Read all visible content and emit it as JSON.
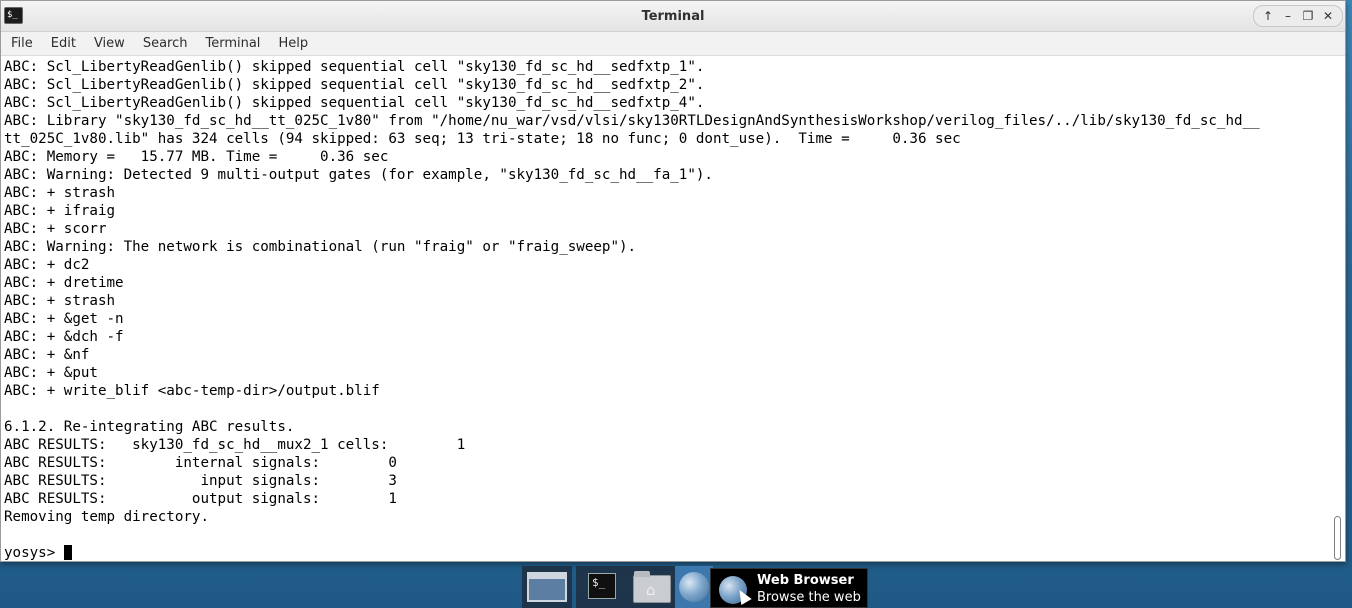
{
  "window": {
    "title": "Terminal",
    "app_icon_glyph": "$_"
  },
  "wm_buttons": {
    "up": "↑",
    "minimize": "–",
    "maximize": "❐",
    "close": "✕"
  },
  "menu": [
    "File",
    "Edit",
    "View",
    "Search",
    "Terminal",
    "Help"
  ],
  "terminal": {
    "lines": [
      "ABC: Scl_LibertyReadGenlib() skipped sequential cell \"sky130_fd_sc_hd__sedfxtp_1\".",
      "ABC: Scl_LibertyReadGenlib() skipped sequential cell \"sky130_fd_sc_hd__sedfxtp_2\".",
      "ABC: Scl_LibertyReadGenlib() skipped sequential cell \"sky130_fd_sc_hd__sedfxtp_4\".",
      "ABC: Library \"sky130_fd_sc_hd__tt_025C_1v80\" from \"/home/nu_war/vsd/vlsi/sky130RTLDesignAndSynthesisWorkshop/verilog_files/../lib/sky130_fd_sc_hd__",
      "tt_025C_1v80.lib\" has 324 cells (94 skipped: 63 seq; 13 tri-state; 18 no func; 0 dont_use).  Time =     0.36 sec",
      "ABC: Memory =   15.77 MB. Time =     0.36 sec",
      "ABC: Warning: Detected 9 multi-output gates (for example, \"sky130_fd_sc_hd__fa_1\").",
      "ABC: + strash",
      "ABC: + ifraig",
      "ABC: + scorr",
      "ABC: Warning: The network is combinational (run \"fraig\" or \"fraig_sweep\").",
      "ABC: + dc2",
      "ABC: + dretime",
      "ABC: + strash",
      "ABC: + &get -n",
      "ABC: + &dch -f",
      "ABC: + &nf",
      "ABC: + &put",
      "ABC: + write_blif <abc-temp-dir>/output.blif",
      "",
      "6.1.2. Re-integrating ABC results.",
      "ABC RESULTS:   sky130_fd_sc_hd__mux2_1 cells:        1",
      "ABC RESULTS:        internal signals:        0",
      "ABC RESULTS:           input signals:        3",
      "ABC RESULTS:          output signals:        1",
      "Removing temp directory.",
      ""
    ],
    "prompt": "yosys> "
  },
  "taskbar": {
    "terminal_glyph": "$_",
    "tooltip_title": "Web Browser",
    "tooltip_subtitle": "Browse the web"
  }
}
